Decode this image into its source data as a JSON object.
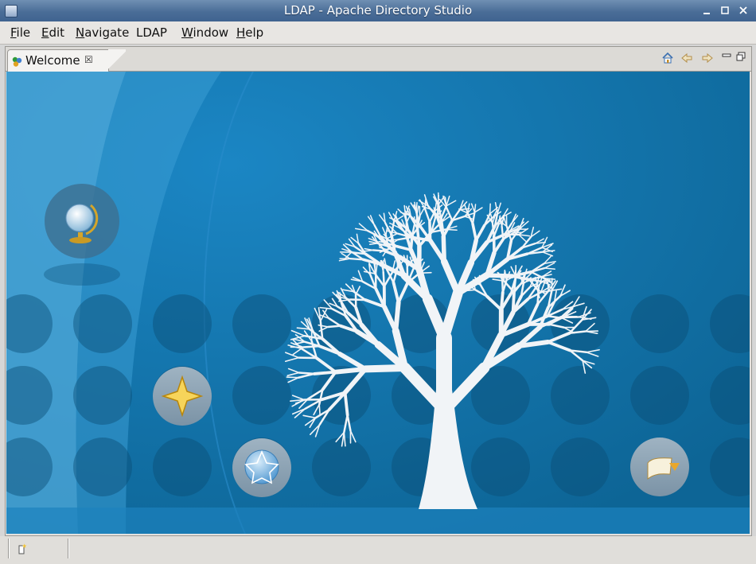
{
  "window": {
    "title": "LDAP - Apache Directory Studio"
  },
  "menu": {
    "items": [
      {
        "first": "F",
        "rest": "ile"
      },
      {
        "first": "E",
        "rest": "dit"
      },
      {
        "first": "N",
        "rest": "avigate"
      },
      {
        "first": "",
        "rest": "LDAP"
      },
      {
        "first": "W",
        "rest": "indow"
      },
      {
        "first": "H",
        "rest": "elp"
      }
    ]
  },
  "editor": {
    "tab_label": "Welcome",
    "tab_close": "☒"
  },
  "welcome": {
    "icons": [
      "globe-icon",
      "star-icon",
      "web-icon",
      "workbench-icon"
    ]
  },
  "colors": {
    "background_dark": "#0d6596",
    "background_light": "#3ba2da",
    "tree": "#f1f4f7",
    "dot": "#0b4e76"
  }
}
